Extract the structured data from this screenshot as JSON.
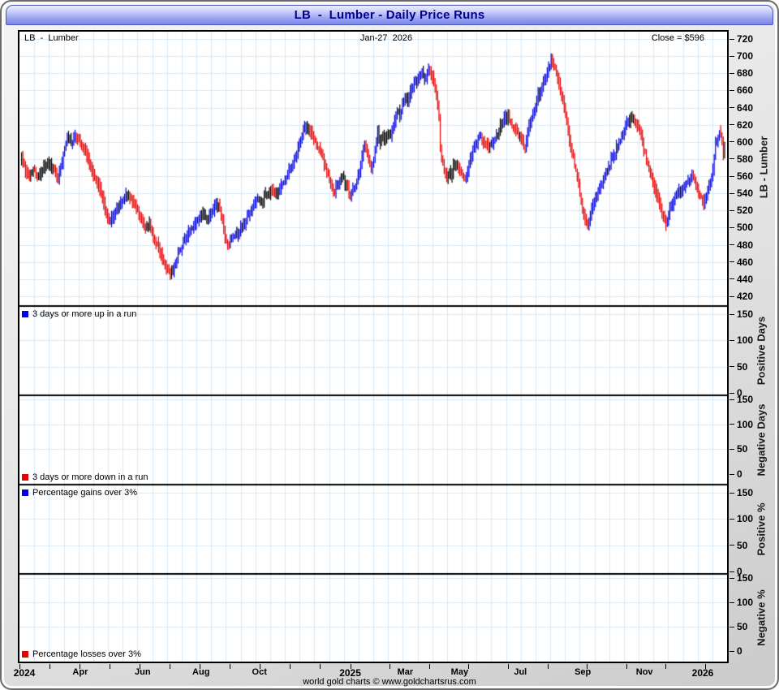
{
  "window": {
    "title": "LB  -  Lumber - Daily Price Runs"
  },
  "header": {
    "left": "LB  -  Lumber",
    "center": "Jan-27  2026",
    "right": "Close = $596"
  },
  "footer": {
    "credit": "world gold charts © www.goldchartsrus.com"
  },
  "colors": {
    "up_run": "#0000e0",
    "down_run": "#e60000",
    "neutral": "#000000",
    "grid": "#d7e7f5",
    "panel_border": "#000000",
    "title_text": "#00008c",
    "background": "#ffffff"
  },
  "x_axis": {
    "labels": [
      {
        "text": "2024",
        "frac": 0.0069,
        "year": true
      },
      {
        "text": "Apr",
        "frac": 0.0859,
        "year": false
      },
      {
        "text": "Jun",
        "frac": 0.1741,
        "year": false
      },
      {
        "text": "Aug",
        "frac": 0.2566,
        "year": false
      },
      {
        "text": "Oct",
        "frac": 0.3391,
        "year": false
      },
      {
        "text": "2025",
        "frac": 0.4674,
        "year": true
      },
      {
        "text": "Mar",
        "frac": 0.5452,
        "year": false
      },
      {
        "text": "May",
        "frac": 0.622,
        "year": false
      },
      {
        "text": "Jul",
        "frac": 0.7079,
        "year": false
      },
      {
        "text": "Sep",
        "frac": 0.7961,
        "year": false
      },
      {
        "text": "Nov",
        "frac": 0.8832,
        "year": false
      },
      {
        "text": "2026",
        "frac": 0.9656,
        "year": true
      }
    ]
  },
  "chart_data": {
    "type": "ohlc-bar",
    "title": "LB - Lumber - Daily Price Runs",
    "symbol": "LB",
    "instrument": "Lumber",
    "last_date": "Jan-27 2026",
    "close": 596,
    "y_axis_title": "LB  -  Lumber",
    "price_axis": {
      "min": 420,
      "max": 720,
      "step": 20,
      "unit": "$"
    },
    "color_rules": {
      "blue": "3 days or more up in a run",
      "red": "3 days or more down in a run",
      "black": "no 3-day run"
    },
    "num_days": 540,
    "price_path": [
      [
        0,
        585
      ],
      [
        3,
        565
      ],
      [
        6,
        560
      ],
      [
        10,
        567
      ],
      [
        14,
        561
      ],
      [
        17,
        571
      ],
      [
        22,
        574
      ],
      [
        25,
        567
      ],
      [
        28,
        556
      ],
      [
        31,
        576
      ],
      [
        35,
        606
      ],
      [
        38,
        599
      ],
      [
        41,
        607
      ],
      [
        45,
        597
      ],
      [
        49,
        588
      ],
      [
        53,
        571
      ],
      [
        57,
        555
      ],
      [
        61,
        539
      ],
      [
        64,
        521
      ],
      [
        67,
        506
      ],
      [
        71,
        515
      ],
      [
        74,
        524
      ],
      [
        77,
        532
      ],
      [
        81,
        538
      ],
      [
        85,
        531
      ],
      [
        88,
        523
      ],
      [
        92,
        509
      ],
      [
        95,
        499
      ],
      [
        98,
        506
      ],
      [
        101,
        489
      ],
      [
        105,
        477
      ],
      [
        108,
        464
      ],
      [
        111,
        453
      ],
      [
        114,
        444
      ],
      [
        118,
        459
      ],
      [
        121,
        473
      ],
      [
        124,
        484
      ],
      [
        127,
        491
      ],
      [
        131,
        499
      ],
      [
        135,
        509
      ],
      [
        139,
        517
      ],
      [
        142,
        511
      ],
      [
        146,
        519
      ],
      [
        149,
        529
      ],
      [
        152,
        521
      ],
      [
        155,
        497
      ],
      [
        158,
        481
      ],
      [
        162,
        489
      ],
      [
        166,
        494
      ],
      [
        170,
        504
      ],
      [
        173,
        514
      ],
      [
        177,
        524
      ],
      [
        181,
        534
      ],
      [
        184,
        532
      ],
      [
        188,
        539
      ],
      [
        192,
        544
      ],
      [
        196,
        541
      ],
      [
        199,
        549
      ],
      [
        203,
        559
      ],
      [
        207,
        571
      ],
      [
        210,
        584
      ],
      [
        214,
        604
      ],
      [
        218,
        617
      ],
      [
        222,
        611
      ],
      [
        225,
        602
      ],
      [
        229,
        589
      ],
      [
        233,
        571
      ],
      [
        236,
        554
      ],
      [
        239,
        541
      ],
      [
        243,
        551
      ],
      [
        246,
        559
      ],
      [
        249,
        551
      ],
      [
        252,
        537
      ],
      [
        256,
        547
      ],
      [
        258,
        560
      ],
      [
        260,
        574
      ],
      [
        261,
        585
      ],
      [
        263,
        597
      ],
      [
        265,
        588
      ],
      [
        267,
        575
      ],
      [
        268,
        570
      ],
      [
        270,
        580
      ],
      [
        272,
        600
      ],
      [
        273,
        612
      ],
      [
        275,
        598
      ],
      [
        277,
        608
      ],
      [
        279,
        602
      ],
      [
        281,
        612
      ],
      [
        283,
        606
      ],
      [
        285,
        618
      ],
      [
        287,
        630
      ],
      [
        288,
        636
      ],
      [
        290,
        630
      ],
      [
        292,
        645
      ],
      [
        294,
        655
      ],
      [
        296,
        648
      ],
      [
        298,
        658
      ],
      [
        300,
        665
      ],
      [
        302,
        670
      ],
      [
        303,
        668
      ],
      [
        305,
        676
      ],
      [
        307,
        682
      ],
      [
        309,
        674
      ],
      [
        311,
        680
      ],
      [
        312,
        686
      ],
      [
        314,
        680
      ],
      [
        317,
        662
      ],
      [
        319,
        641
      ],
      [
        320,
        629
      ],
      [
        321,
        592
      ],
      [
        324,
        568
      ],
      [
        326,
        556
      ],
      [
        328,
        567
      ],
      [
        330,
        560
      ],
      [
        331,
        573
      ],
      [
        333,
        574
      ],
      [
        336,
        568
      ],
      [
        338,
        560
      ],
      [
        340,
        556
      ],
      [
        342,
        565
      ],
      [
        343,
        574
      ],
      [
        347,
        594
      ],
      [
        351,
        607
      ],
      [
        355,
        599
      ],
      [
        358,
        594
      ],
      [
        362,
        601
      ],
      [
        366,
        614
      ],
      [
        369,
        624
      ],
      [
        373,
        631
      ],
      [
        377,
        617
      ],
      [
        381,
        607
      ],
      [
        384,
        601
      ],
      [
        386,
        590
      ],
      [
        388,
        610
      ],
      [
        390,
        622
      ],
      [
        392,
        634
      ],
      [
        395,
        649
      ],
      [
        399,
        664
      ],
      [
        403,
        681
      ],
      [
        406,
        696
      ],
      [
        409,
        687
      ],
      [
        412,
        667
      ],
      [
        415,
        651
      ],
      [
        418,
        624
      ],
      [
        421,
        594
      ],
      [
        425,
        567
      ],
      [
        428,
        539
      ],
      [
        431,
        514
      ],
      [
        434,
        504
      ],
      [
        437,
        521
      ],
      [
        440,
        534
      ],
      [
        443,
        547
      ],
      [
        447,
        561
      ],
      [
        450,
        571
      ],
      [
        454,
        584
      ],
      [
        458,
        599
      ],
      [
        462,
        611
      ],
      [
        465,
        624
      ],
      [
        469,
        629
      ],
      [
        473,
        617
      ],
      [
        476,
        599
      ],
      [
        479,
        579
      ],
      [
        482,
        561
      ],
      [
        485,
        547
      ],
      [
        488,
        534
      ],
      [
        491,
        514
      ],
      [
        494,
        504
      ],
      [
        497,
        524
      ],
      [
        500,
        534
      ],
      [
        503,
        541
      ],
      [
        507,
        547
      ],
      [
        511,
        554
      ],
      [
        514,
        561
      ],
      [
        517,
        551
      ],
      [
        520,
        537
      ],
      [
        523,
        527
      ],
      [
        526,
        544
      ],
      [
        529,
        557
      ],
      [
        532,
        599
      ],
      [
        535,
        611
      ],
      [
        537,
        604
      ],
      [
        538,
        583
      ],
      [
        539,
        596
      ]
    ],
    "panels": [
      {
        "id": "positive-days",
        "legend": "3 days or more up in a run",
        "legend_color": "#0000e0",
        "legend_pos": "top",
        "axis_label": "Positive Days",
        "axis_ticks": [
          0,
          50,
          100,
          150
        ],
        "values": []
      },
      {
        "id": "negative-days",
        "legend": "3 days or more down in a run",
        "legend_color": "#e60000",
        "legend_pos": "bottom",
        "axis_label": "Negative Days",
        "axis_ticks": [
          0,
          50,
          100,
          150
        ],
        "values": []
      },
      {
        "id": "positive-pct",
        "legend": "Percentage gains over 3%",
        "legend_color": "#0000e0",
        "legend_pos": "top",
        "axis_label": "Positive %",
        "axis_ticks": [
          0,
          50,
          100,
          150
        ],
        "values": []
      },
      {
        "id": "negative-pct",
        "legend": "Percentage losses over 3%",
        "legend_color": "#e60000",
        "legend_pos": "bottom",
        "axis_label": "Negative %",
        "axis_ticks": [
          0,
          50,
          100,
          150
        ],
        "values": []
      }
    ]
  }
}
